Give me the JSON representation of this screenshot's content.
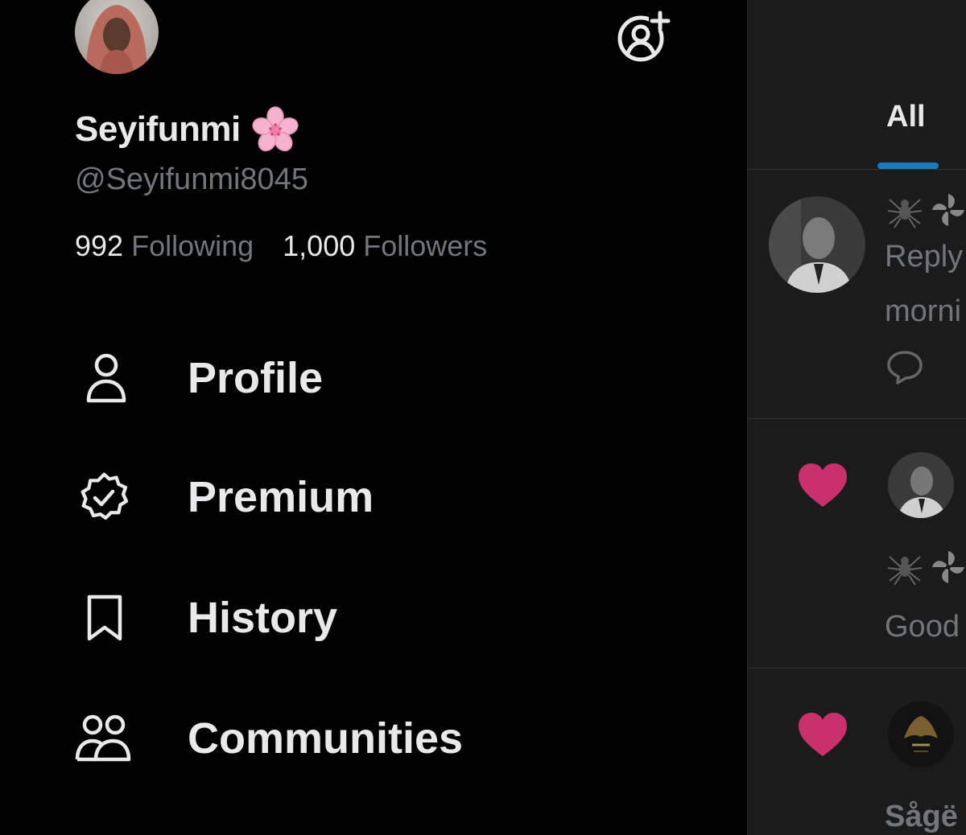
{
  "profile": {
    "display_name": "Seyifunmi",
    "handle": "@Seyifunmi8045",
    "following_count": "992",
    "following_label": "Following",
    "followers_count": "1,000",
    "followers_label": "Followers",
    "name_emoji": "cherry-blossom-icon"
  },
  "menu": {
    "items": [
      {
        "label": "Profile",
        "icon": "person-icon"
      },
      {
        "label": "Premium",
        "icon": "verified-badge-icon"
      },
      {
        "label": "History",
        "icon": "bookmark-icon"
      },
      {
        "label": "Communities",
        "icon": "communities-icon"
      }
    ]
  },
  "notifications": {
    "tab_all": "All",
    "items": [
      {
        "preview_1": "Reply",
        "preview_2": "morni"
      },
      {
        "preview_1": "Good"
      },
      {
        "preview_1": "Sågë"
      }
    ]
  },
  "colors": {
    "background": "#000000",
    "panel_background": "#1b1b1b",
    "text_primary": "#e7e9ea",
    "text_secondary": "#71767b",
    "accent": "#1d9bf0",
    "like": "#c8306e"
  }
}
